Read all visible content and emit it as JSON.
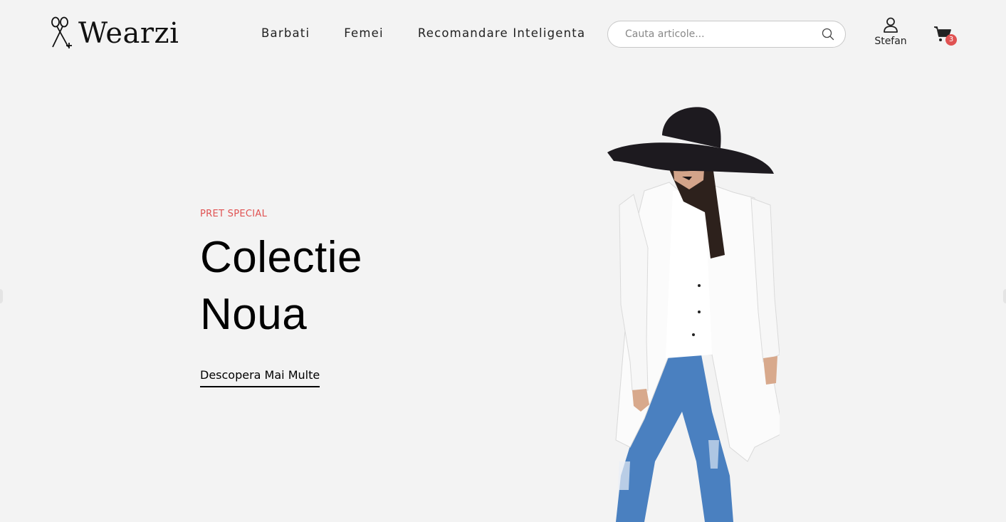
{
  "brand": {
    "name": "Wearzi",
    "logo_icon": "scissors-icon"
  },
  "nav": {
    "items": [
      {
        "label": "Barbati"
      },
      {
        "label": "Femei"
      },
      {
        "label": "Recomandare Inteligenta"
      }
    ]
  },
  "search": {
    "placeholder": "Cauta articole...",
    "value": "",
    "icon": "search-icon"
  },
  "user": {
    "name": "Stefan",
    "icon": "user-icon"
  },
  "cart": {
    "count": "3",
    "icon": "cart-icon"
  },
  "hero": {
    "eyebrow": "PRET SPECIAL",
    "title_line1": "Colectie",
    "title_line2": "Noua",
    "cta_label": "Descopera Mai Multe"
  },
  "colors": {
    "background": "#f3f3f3",
    "accent": "#e05252",
    "text": "#111111"
  }
}
